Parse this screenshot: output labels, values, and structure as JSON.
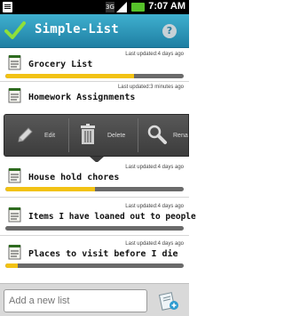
{
  "status_bar": {
    "time": "7:07 AM",
    "network": "3G"
  },
  "app": {
    "title": "Simple-List",
    "help_label": "?"
  },
  "lists": [
    {
      "name": "Grocery List",
      "updated": "Last updated:4 days ago",
      "progress": 0.72
    },
    {
      "name": "Homework Assignments",
      "updated": "Last updated:3 minutes ago",
      "progress": 0.0
    },
    {
      "name": "House hold chores",
      "updated": "Last updated:4 days ago",
      "progress": 0.5
    },
    {
      "name": "Items I have loaned out to people",
      "updated": "Last updated:4 days ago",
      "progress": 0.0
    },
    {
      "name": "Places to visit before I die",
      "updated": "Last updated:4 days ago",
      "progress": 0.07
    }
  ],
  "actions": {
    "edit": "Edit",
    "delete": "Delete",
    "rename": "Rena"
  },
  "new_list": {
    "placeholder": "Add a new list"
  },
  "colors": {
    "accent": "#2a8db3",
    "progress": "#f2c214",
    "track": "#6a6a6a",
    "action_bar": "#474747"
  }
}
